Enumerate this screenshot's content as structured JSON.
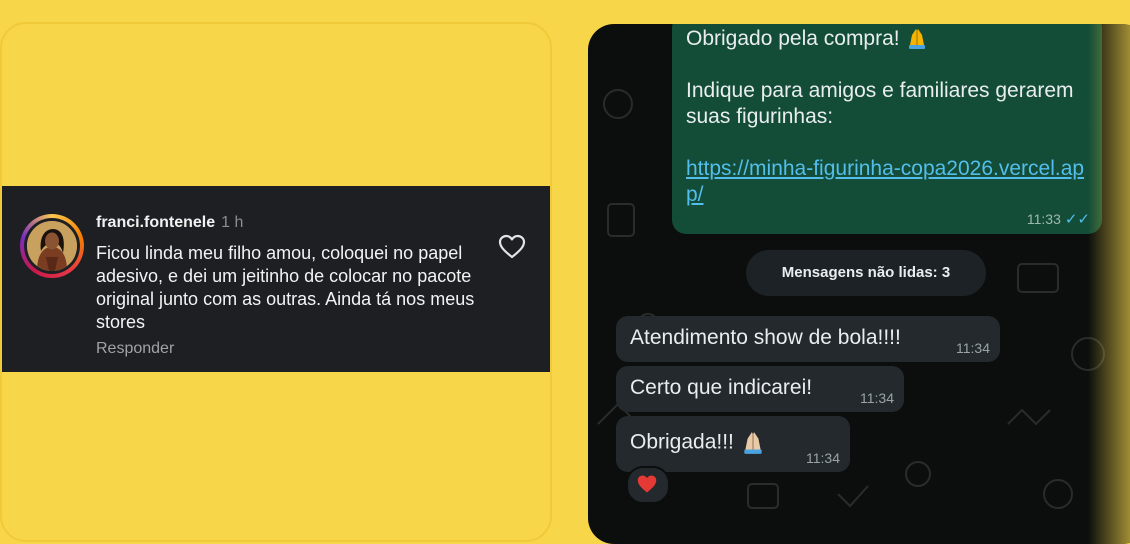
{
  "instagram": {
    "username": "franci.fontenele",
    "time": "1 h",
    "comment": "Ficou linda meu filho amou, coloquei no papel adesivo, e dei um jeitinho de colocar no pacote original junto com as outras. Ainda tá nos meus stores",
    "reply_label": "Responder"
  },
  "whatsapp": {
    "sent": {
      "line1": "Obrigado pela compra!",
      "line2": "Indique para amigos e familiares gerarem suas figurinhas:",
      "link": "https://minha-figurinha-copa2026.vercel.app/",
      "time": "11:33"
    },
    "unread_label": "Mensagens não lidas: 3",
    "received": [
      {
        "text": "Atendimento show de bola!!!!",
        "time": "11:34"
      },
      {
        "text": "Certo que indicarei!",
        "time": "11:34"
      },
      {
        "text": "Obrigada!!!",
        "time": "11:34"
      }
    ]
  },
  "colors": {
    "background": "#f8d64a",
    "ig_panel": "#1d1f23",
    "wa_background": "#0b0e0d",
    "wa_sent_bubble": "#134d37",
    "wa_received_bubble": "#23292d",
    "wa_link": "#53bdeb"
  },
  "icons": {
    "like": "heart-outline-icon",
    "pray": "folded-hands-emoji",
    "reaction": "red-heart-emoji",
    "read": "double-check-icon"
  }
}
